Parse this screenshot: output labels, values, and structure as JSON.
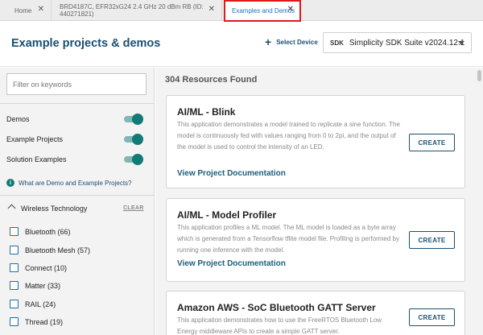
{
  "tabs": [
    {
      "label": "Home"
    },
    {
      "label": "BRD4187C, EFR32xG24 2.4 GHz 20 dBm RB (ID: 440271821)"
    },
    {
      "label": "Examples and Demos"
    }
  ],
  "header": {
    "title": "Example projects & demos",
    "select_device": "Select Device",
    "sdk_tag": "SDK",
    "sdk_value": "Simplicity SDK Suite v2024.12.1"
  },
  "filter": {
    "placeholder": "Filter on keywords",
    "toggles": [
      {
        "label": "Demos",
        "on": true
      },
      {
        "label": "Example Projects",
        "on": true
      },
      {
        "label": "Solution Examples",
        "on": true
      }
    ],
    "info_link": "What are Demo and Example Projects?",
    "section": {
      "title": "Wireless Technology",
      "clear": "CLEAR",
      "items": [
        {
          "label": "Bluetooth (66)"
        },
        {
          "label": "Bluetooth Mesh (57)"
        },
        {
          "label": "Connect (10)"
        },
        {
          "label": "Matter (33)"
        },
        {
          "label": "RAIL (24)"
        },
        {
          "label": "Thread (19)"
        }
      ]
    }
  },
  "results": {
    "count": "304 Resources Found",
    "cards": [
      {
        "title": "AI/ML - Blink",
        "description": "This application demonstrates a model trained to replicate a sine function. The model is continuously fed with values ranging from 0 to 2pi, and the output of the model is used to control the intensity of an LED.",
        "link": "View Project Documentation",
        "button": "CREATE"
      },
      {
        "title": "AI/ML - Model Profiler",
        "description": "This application profiles a ML model. The ML model is loaded as a byte array which is generated from a Tensorflow tflite model file. Profiling is performed by running one inference with the model.",
        "link": "View Project Documentation",
        "button": "CREATE"
      },
      {
        "title": "Amazon AWS - SoC Bluetooth GATT Server",
        "description": "This application demonstrates how to use the FreeRTOS Bluetooth Low Energy middleware APIs to create a simple GATT server.",
        "button": "CREATE"
      }
    ]
  },
  "colors": {
    "accent": "#137b76",
    "link": "#1b4f72",
    "highlight": "#e01919"
  }
}
